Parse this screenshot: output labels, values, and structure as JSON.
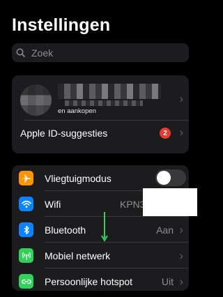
{
  "page": {
    "title": "Instellingen"
  },
  "search": {
    "placeholder": "Zoek",
    "icon": "search-icon"
  },
  "account": {
    "subtitle_line": "en aankopen",
    "apple_id_suggestions_label": "Apple ID-suggesties",
    "badge_count": "2"
  },
  "settings": {
    "airplane": {
      "label": "Vliegtuigmodus",
      "icon": "airplane-icon",
      "color": "#ff9500",
      "toggle_on": false
    },
    "wifi": {
      "label": "Wifi",
      "value": "KPN3",
      "icon": "wifi-icon",
      "color": "#0a84ff"
    },
    "bluetooth": {
      "label": "Bluetooth",
      "value": "Aan",
      "icon": "bluetooth-icon",
      "color": "#0a84ff"
    },
    "cellular": {
      "label": "Mobiel netwerk",
      "icon": "antenna-icon",
      "color": "#30d158"
    },
    "hotspot": {
      "label": "Persoonlijke hotspot",
      "value": "Uit",
      "icon": "hotspot-icon",
      "color": "#30d158"
    }
  },
  "annotation": {
    "arrow_color": "#30d158"
  }
}
